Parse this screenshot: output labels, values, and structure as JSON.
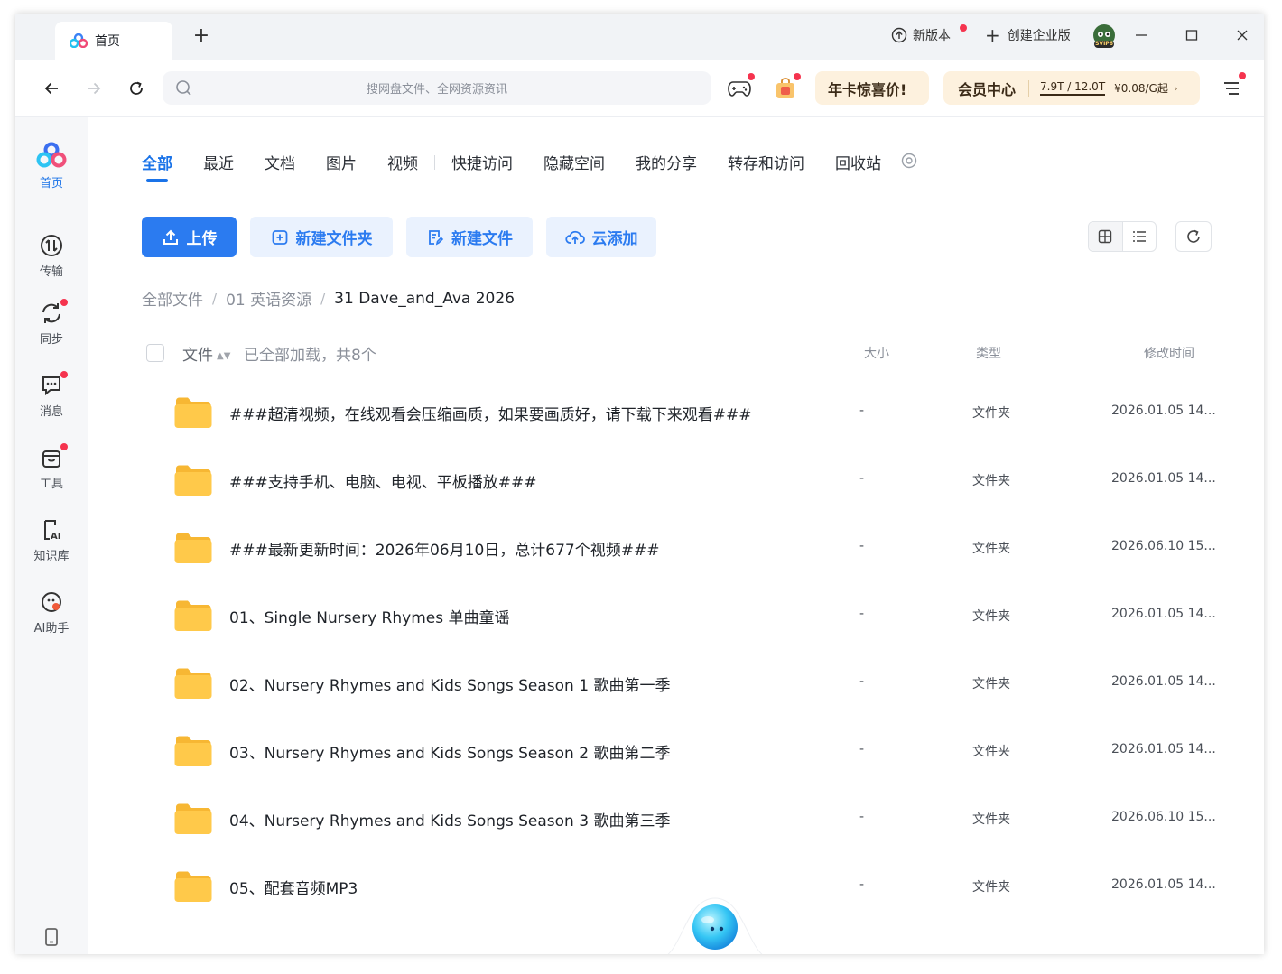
{
  "titlebar": {
    "tab_label": "首页",
    "new_version": "新版本",
    "create_enterprise": "创建企业版",
    "avatar_text": "SVIP6"
  },
  "nav": {
    "search_placeholder": "搜网盘文件、全网资源资讯",
    "promo_card": "年卡惊喜价!",
    "vip_center": "会员中心",
    "storage": "7.9T / 12.0T",
    "price": "¥0.08/G起"
  },
  "sidebar": {
    "items": [
      {
        "label": "首页",
        "icon": "home-logo-icon"
      },
      {
        "label": "传输",
        "icon": "transfer-icon"
      },
      {
        "label": "同步",
        "icon": "sync-icon"
      },
      {
        "label": "消息",
        "icon": "message-icon"
      },
      {
        "label": "工具",
        "icon": "toolbox-icon"
      },
      {
        "label": "知识库",
        "icon": "knowledge-ai-icon"
      },
      {
        "label": "AI助手",
        "icon": "ai-assistant-icon"
      }
    ]
  },
  "categories": [
    "全部",
    "最近",
    "文档",
    "图片",
    "视频",
    "快捷访问",
    "隐藏空间",
    "我的分享",
    "转存和访问",
    "回收站"
  ],
  "actions": {
    "upload": "上传",
    "new_folder": "新建文件夹",
    "new_file": "新建文件",
    "cloud_add": "云添加"
  },
  "breadcrumb": [
    "全部文件",
    "01 英语资源",
    "31 Dave_and_Ava 2026"
  ],
  "list_header": {
    "name": "文件",
    "loaded": "已全部加载，共8个",
    "size": "大小",
    "type": "类型",
    "mtime": "修改时间"
  },
  "files": [
    {
      "name": "###超清视频，在线观看会压缩画质，如果要画质好，请下载下来观看###",
      "size": "-",
      "type": "文件夹",
      "mtime": "2026.01.05 14..."
    },
    {
      "name": "###支持手机、电脑、电视、平板播放###",
      "size": "-",
      "type": "文件夹",
      "mtime": "2026.01.05 14..."
    },
    {
      "name": "###最新更新时间：2026年06月10日，总计677个视频###",
      "size": "-",
      "type": "文件夹",
      "mtime": "2026.06.10 15..."
    },
    {
      "name": "01、Single Nursery Rhymes 单曲童谣",
      "size": "-",
      "type": "文件夹",
      "mtime": "2026.01.05 14..."
    },
    {
      "name": "02、Nursery Rhymes and Kids Songs Season 1 歌曲第一季",
      "size": "-",
      "type": "文件夹",
      "mtime": "2026.01.05 14..."
    },
    {
      "name": "03、Nursery Rhymes and Kids Songs Season 2 歌曲第二季",
      "size": "-",
      "type": "文件夹",
      "mtime": "2026.01.05 14..."
    },
    {
      "name": "04、Nursery Rhymes and Kids Songs Season 3 歌曲第三季",
      "size": "-",
      "type": "文件夹",
      "mtime": "2026.06.10 15..."
    },
    {
      "name": "05、配套音频MP3",
      "size": "-",
      "type": "文件夹",
      "mtime": "2026.01.05 14..."
    }
  ],
  "colors": {
    "accent": "#2b7bf0",
    "folder": "#ffc94a",
    "badge": "#f5334e",
    "promo_bg": "#fdf1de"
  }
}
